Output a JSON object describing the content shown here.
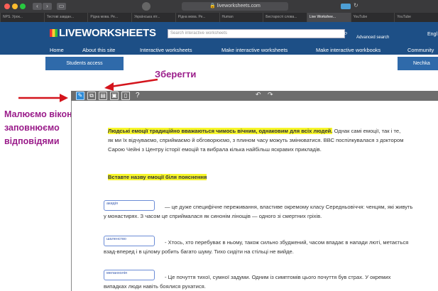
{
  "browser": {
    "url": "liveworksheets.com",
    "tabs": [
      "NPS. Урок...",
      "Тестові завдан...",
      "Рідна мова. Ре...",
      "Українська літ...",
      "Рідна мова. Ре...",
      "Human",
      "Бестарості слова...",
      "Live Workshee...",
      "YouTube",
      "YouTube"
    ],
    "active_tab_index": 7
  },
  "site": {
    "logo": "LIVEWORKSHEETS",
    "search_placeholder": "Search interactive worksheets",
    "advanced_search": "Advanced search",
    "language": "Engl",
    "nav": [
      "Home",
      "About this site",
      "Interactive worksheets",
      "Make interactive worksheets",
      "Make interactive workbooks",
      "Community"
    ],
    "students_access": "Students access",
    "user": "Nechka"
  },
  "annotations": {
    "save": "Зберегти",
    "fill": [
      "Малюємо віконця",
      "заповнюємо",
      "відповідями"
    ]
  },
  "toolbar": {
    "help": "?",
    "undo": "↶",
    "redo": "↷"
  },
  "worksheet": {
    "intro_highlight": "Людські емоції традиційно вважаються чимось вічним, однаковим для всіх людей.",
    "intro_rest": " Однак самі емоції, так і те, як ми їх відчуваємо, сприймаємо й обговорюємо, з плином часу можуть змінюватися. ВВС поспілкувалася з доктором Сарою Чейні з Центру історії емоцій та вибрала кілька найбільш яскравих прикладів.",
    "instruction": "Вставте назву емоції біля пояснення",
    "items": [
      {
        "answer": "акидія",
        "text": "— це дуже специфічне переживання, властиве окремому класу Середньовіччя: ченцям, які живуть у монастирях. З часом це сприймалася як синонім лінощів — одного зі смертних гріхів."
      },
      {
        "answer": "шаленство",
        "text": "- Хтось, хто перебуває в ньому, також сильно збуджений, часом впадає в напади люті, метається взад-вперед і в цілому робить багато шуму. Тихо сидіти на стільці не вийде."
      },
      {
        "answer": "меланхолія",
        "text": "- Це почуття тихої, сумної задуми. Одним із симптомів цього почуття був страх. У окремих випадках люди навіть боялися рухатися."
      }
    ]
  },
  "colors": {
    "header": "#1d4f86",
    "annotation": "#9a1c8a",
    "arrow": "#d4141c",
    "highlight": "#f6f52a",
    "selected_tool": "#2e8bd6"
  }
}
